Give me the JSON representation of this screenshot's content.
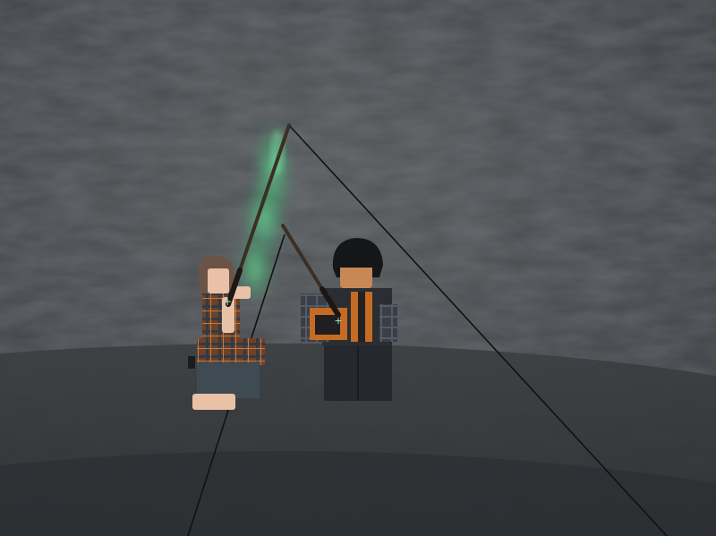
{
  "scene": {
    "environment": "cave",
    "palette": {
      "wall": "#44474a",
      "wall_dark": "#2c2f32",
      "floor": "#35383b",
      "glow": "#4fd98a",
      "rope": "#111111",
      "plaid_a": "#7a4a2a",
      "plaid_b": "#2e3a44",
      "skin_a": "#e8c1a6",
      "skin_b": "#c88757",
      "hair_a": "#6b5446",
      "hair_b": "#141618",
      "clothes_dark": "#2a2d31",
      "accent_orange": "#c56b24"
    },
    "objects": [
      {
        "name": "cave-wall",
        "kind": "background"
      },
      {
        "name": "cave-floor",
        "kind": "ground"
      },
      {
        "name": "green-smoke",
        "kind": "effect"
      },
      {
        "name": "character-left",
        "kind": "avatar",
        "hair": "brown",
        "outfit": "plaid-dress"
      },
      {
        "name": "character-right",
        "kind": "avatar",
        "hair": "black",
        "outfit": "dark-jacket"
      },
      {
        "name": "fishing-rod-left",
        "kind": "item"
      },
      {
        "name": "fishing-rod-right",
        "kind": "item"
      },
      {
        "name": "fishing-line",
        "kind": "item"
      },
      {
        "name": "cursor-crosshair",
        "kind": "hud"
      }
    ]
  }
}
